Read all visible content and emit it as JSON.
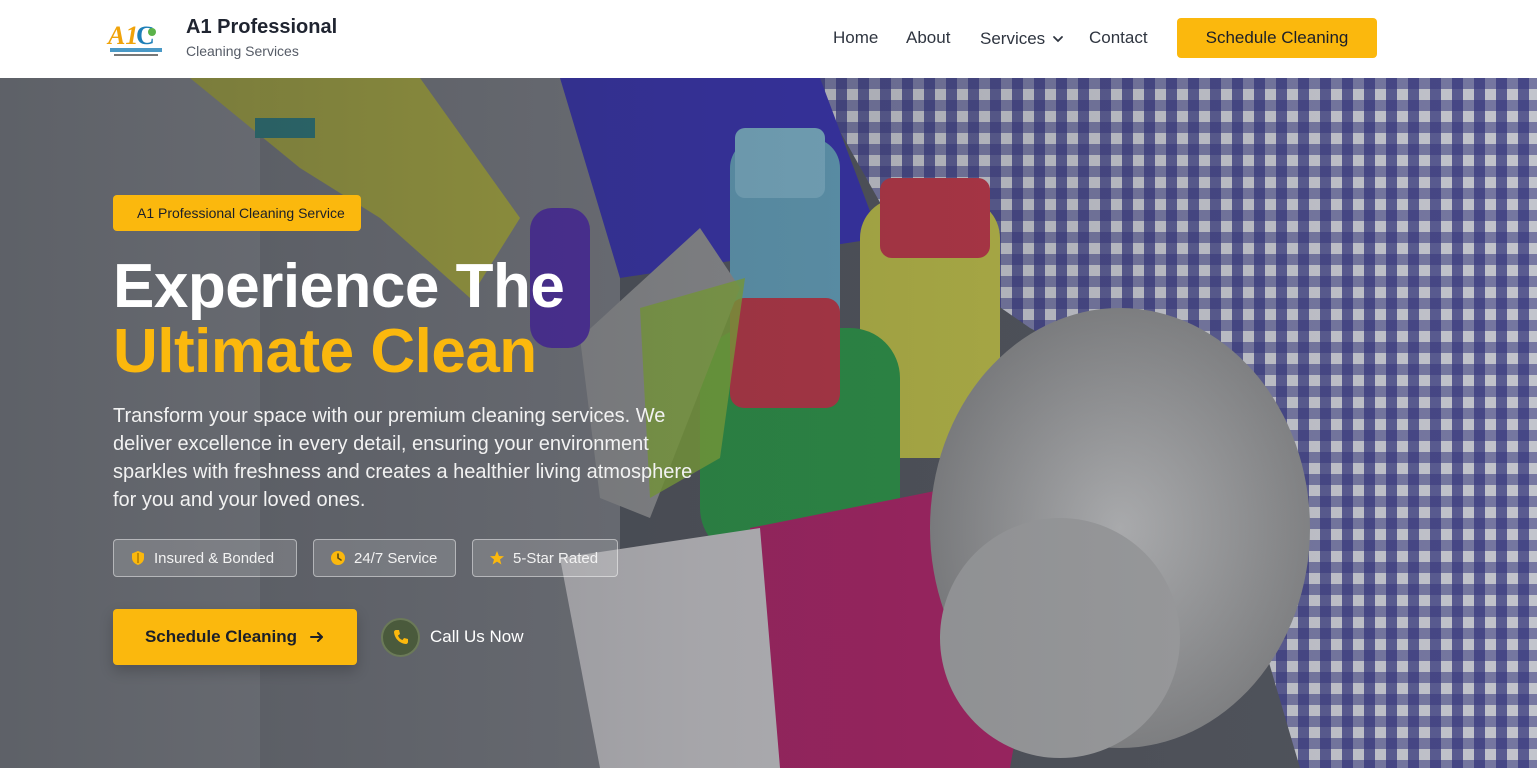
{
  "brand": {
    "title": "A1 Professional",
    "subtitle": "Cleaning Services",
    "logo_text": "A1C",
    "logo_caption": "PROFESSIONAL CLEANING"
  },
  "nav": {
    "items": [
      {
        "label": "Home"
      },
      {
        "label": "About"
      },
      {
        "label": "Services"
      },
      {
        "label": "Contact"
      }
    ],
    "cta_label": "Schedule Cleaning"
  },
  "hero": {
    "badge": "A1 Professional Cleaning Service",
    "headline_line1": "Experience The",
    "headline_line2": "Ultimate Clean",
    "description": "Transform your space with our premium cleaning services. We deliver excellence in every detail, ensuring your environment sparkles with freshness and creates a healthier living atmosphere for you and your loved ones.",
    "features": [
      {
        "label": "Insured & Bonded",
        "icon": "shield-icon"
      },
      {
        "label": "24/7 Service",
        "icon": "clock-icon"
      },
      {
        "label": "5-Star Rated",
        "icon": "star-icon"
      }
    ],
    "cta_label": "Schedule Cleaning",
    "call_label": "Call Us Now"
  },
  "colors": {
    "accent": "#fbb80d",
    "dark_text": "#1b1f29",
    "white": "#ffffff"
  }
}
